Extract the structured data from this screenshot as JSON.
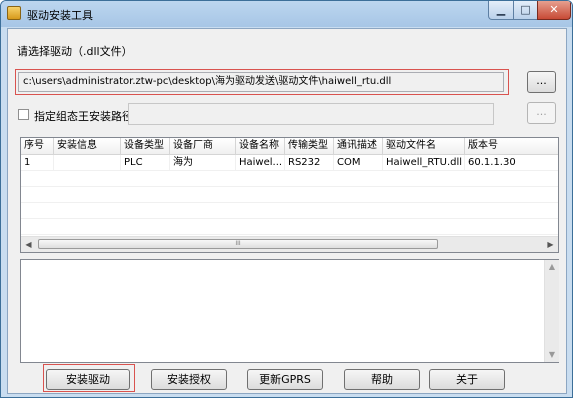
{
  "window": {
    "title": "驱动安装工具",
    "controls": {
      "minimize": "▁",
      "maximize": "□",
      "close": "✕"
    }
  },
  "driver_section": {
    "label": "请选择驱动（.dll文件）",
    "path_value": "c:\\users\\administrator.ztw-pc\\desktop\\海为驱动发送\\驱动文件\\haiwell_rtu.dll",
    "browse_label": "...",
    "checkbox_label": "指定组态王安装路径",
    "checkbox_checked": false,
    "install_path_value": "",
    "browse2_label": "..."
  },
  "table": {
    "columns": [
      "序号",
      "安装信息",
      "设备类型",
      "设备厂商",
      "设备名称",
      "传输类型",
      "通讯描述",
      "驱动文件名",
      "版本号"
    ],
    "rows": [
      [
        "1",
        "",
        "PLC",
        "海为",
        "Haiwel...",
        "RS232",
        "COM",
        "Haiwell_RTU.dll",
        "60.1.1.30"
      ]
    ],
    "scroll_grip": "III"
  },
  "log": {
    "text": ""
  },
  "buttons": {
    "install": "安装驱动",
    "auth": "安装授权",
    "gprs": "更新GPRS",
    "help": "帮助",
    "about": "关于"
  },
  "colors": {
    "highlight_border": "#d9534f",
    "title_bar": "#bcd6ef",
    "client_bg": "#f0f0f0"
  }
}
